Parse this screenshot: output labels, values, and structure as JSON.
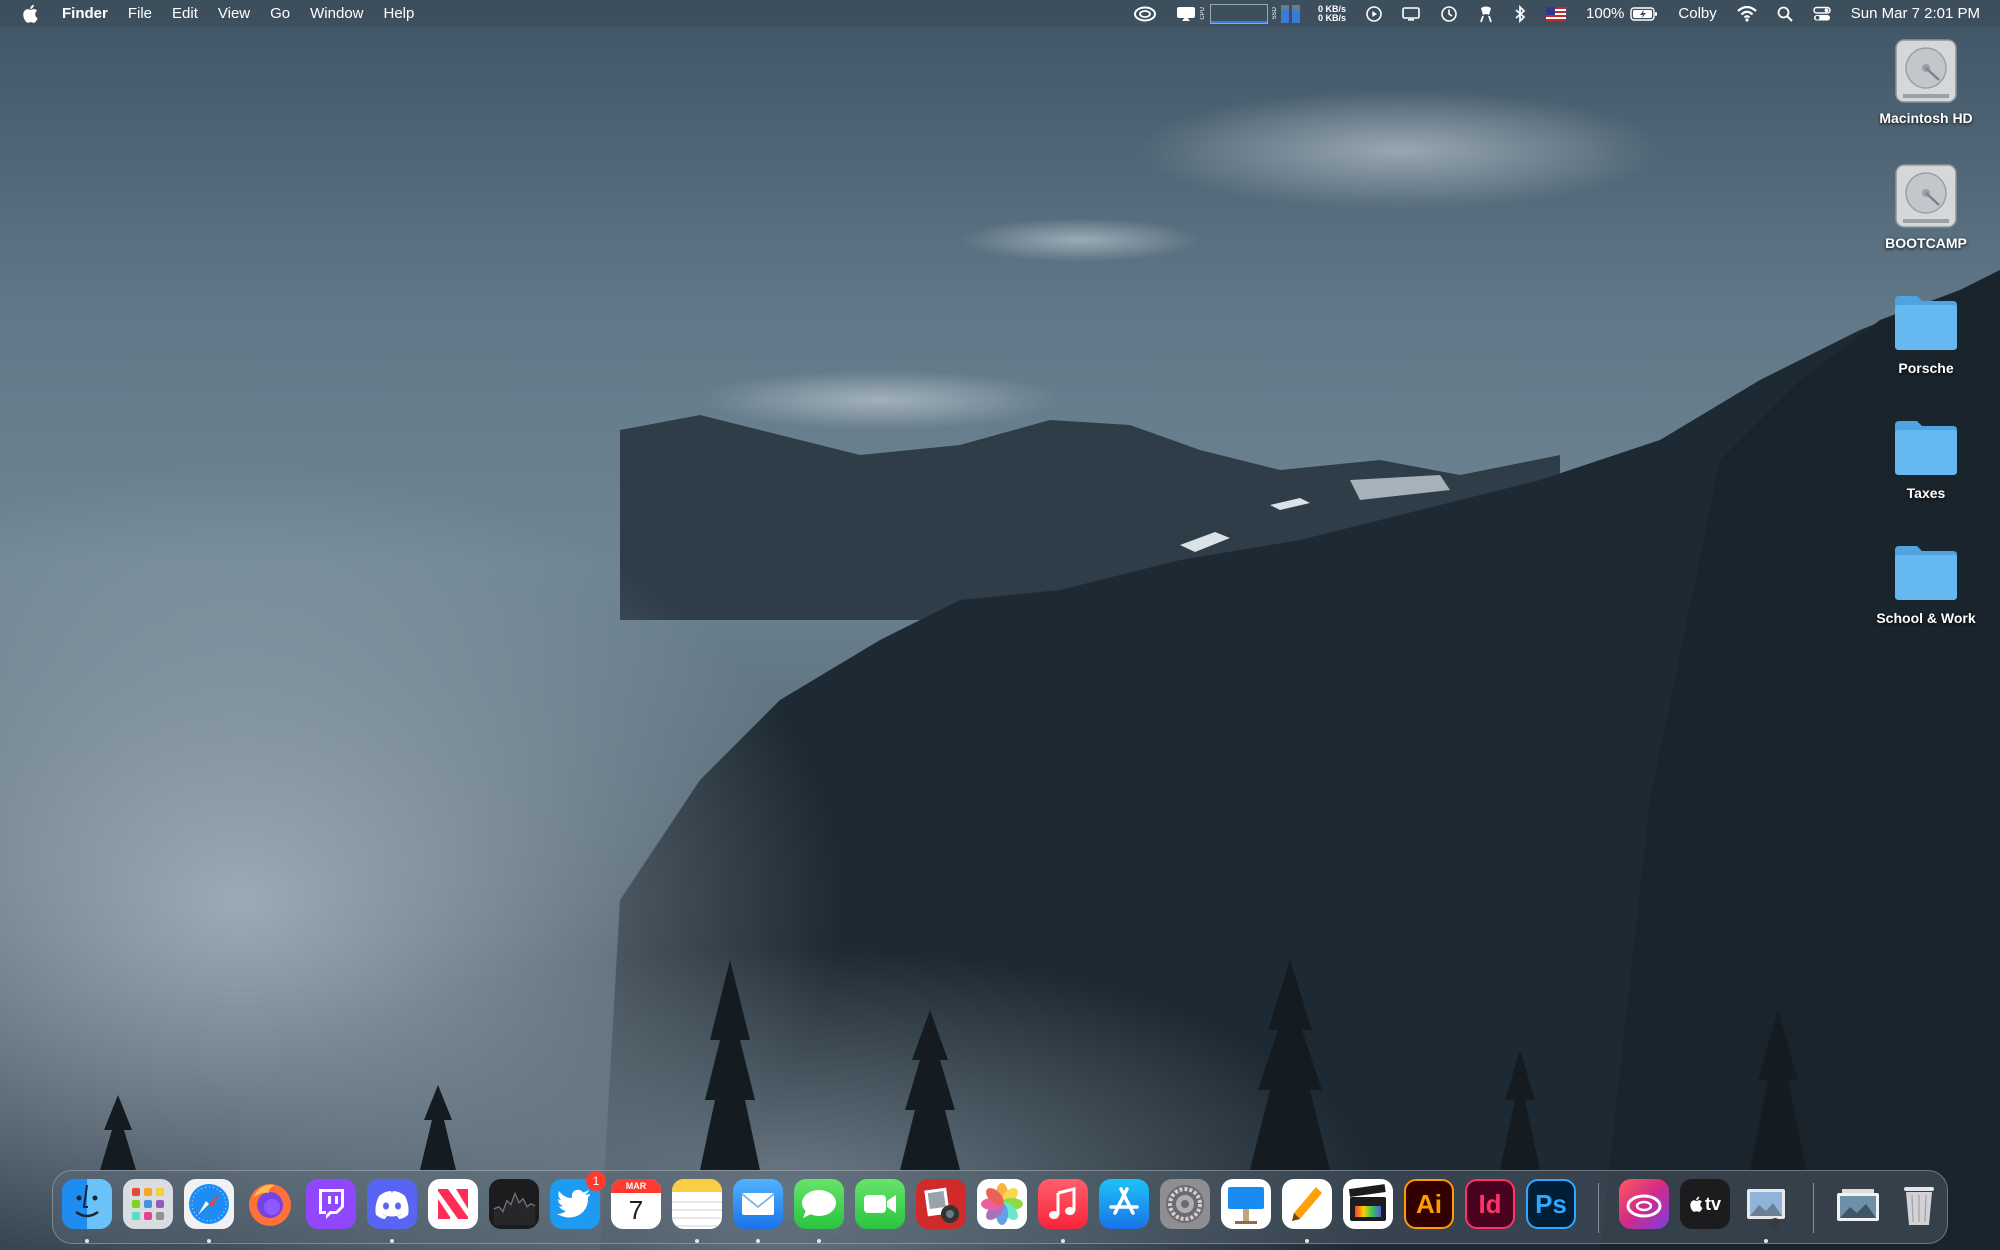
{
  "menubar": {
    "app_name": "Finder",
    "menus": [
      "File",
      "Edit",
      "View",
      "Go",
      "Window",
      "Help"
    ],
    "status": {
      "cpu_label": "CPU",
      "ssd_label": "SSD",
      "net_up": "0 KB/s",
      "net_down": "0 KB/s",
      "battery": "100%",
      "user": "Colby",
      "clock": "Sun Mar 7  2:01 PM"
    }
  },
  "desktop": {
    "icons": [
      {
        "label": "Macintosh HD",
        "kind": "hard-drive"
      },
      {
        "label": "BOOTCAMP",
        "kind": "hard-drive"
      },
      {
        "label": "Porsche",
        "kind": "folder"
      },
      {
        "label": "Taxes",
        "kind": "folder"
      },
      {
        "label": "School & Work",
        "kind": "folder"
      }
    ]
  },
  "dock": {
    "apps": [
      {
        "name": "Finder",
        "running": true
      },
      {
        "name": "Launchpad",
        "running": false
      },
      {
        "name": "Safari",
        "running": true
      },
      {
        "name": "Firefox",
        "running": false
      },
      {
        "name": "Twitch",
        "running": false
      },
      {
        "name": "Discord",
        "running": true
      },
      {
        "name": "News",
        "running": false
      },
      {
        "name": "Stocks",
        "running": false
      },
      {
        "name": "Twitter",
        "running": false,
        "badge": "1"
      },
      {
        "name": "Calendar",
        "running": false,
        "month": "MAR",
        "day": "7"
      },
      {
        "name": "Notes",
        "running": true
      },
      {
        "name": "Mail",
        "running": true
      },
      {
        "name": "Messages",
        "running": true
      },
      {
        "name": "FaceTime",
        "running": false
      },
      {
        "name": "Photo Booth",
        "running": false
      },
      {
        "name": "Photos",
        "running": false
      },
      {
        "name": "Music",
        "running": true
      },
      {
        "name": "App Store",
        "running": false
      },
      {
        "name": "System Preferences",
        "running": false
      },
      {
        "name": "Keynote",
        "running": false
      },
      {
        "name": "Pages",
        "running": true
      },
      {
        "name": "Final Cut Pro",
        "running": false
      },
      {
        "name": "Illustrator",
        "running": false,
        "text": "Ai"
      },
      {
        "name": "InDesign",
        "running": false,
        "text": "Id"
      },
      {
        "name": "Photoshop",
        "running": false,
        "text": "Ps"
      },
      {
        "name": "Creative Cloud",
        "running": false
      },
      {
        "name": "Apple TV",
        "running": false,
        "text": "tv"
      },
      {
        "name": "Preview",
        "running": true
      },
      {
        "name": "Downloads",
        "running": false
      },
      {
        "name": "Trash",
        "running": false
      }
    ]
  },
  "colors": {
    "menubar_bg": "#3a4a56",
    "accent_blue": "#3a7bd5",
    "folder_blue": "#5eb3ef",
    "badge_red": "#ff3b30"
  }
}
